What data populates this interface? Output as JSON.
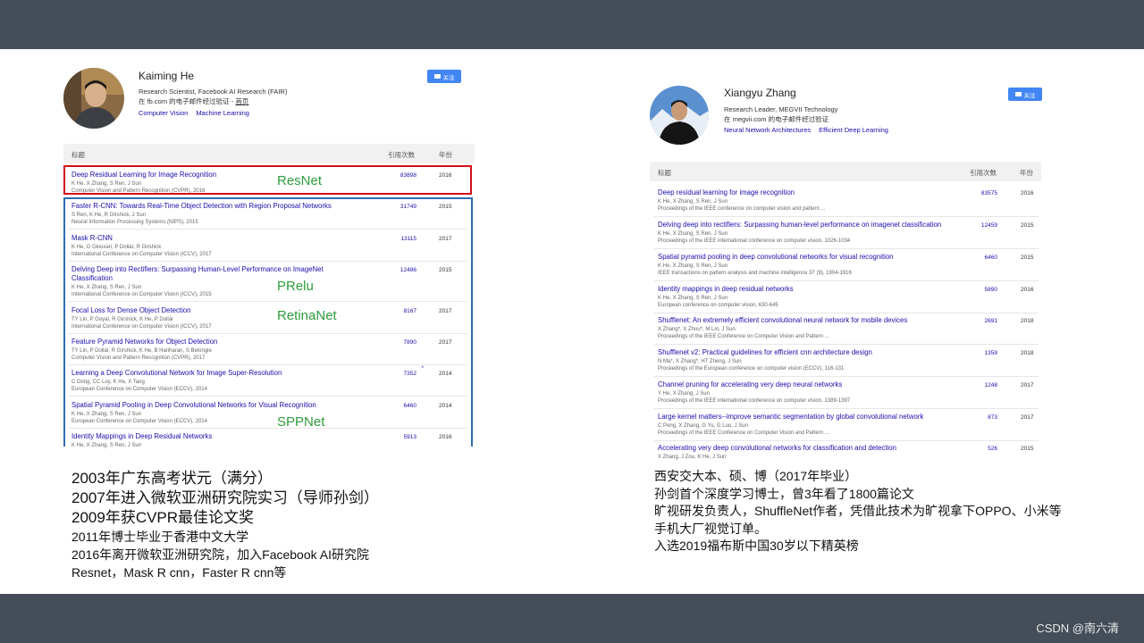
{
  "watermark": "CSDN @南六清",
  "left": {
    "name": "Kaiming He",
    "affiliation": "Research Scientist, Facebook AI Research (FAIR)",
    "email_prefix": "在 fb.com 的电子邮件经过验证 - ",
    "email_link": "首页",
    "tags": [
      "Computer Vision",
      "Machine Learning"
    ],
    "follow": "关注",
    "header": {
      "title": "标题",
      "cites": "引用次数",
      "year": "年份"
    },
    "rows": [
      {
        "title": "Deep Residual Learning for Image Recognition",
        "authors": "K He, X Zhang, S Ren, J Sun",
        "venue": "Computer Vision and Pattern Recognition (CVPR), 2016",
        "cites": "83898",
        "year": "2016"
      },
      {
        "title": "Faster R-CNN: Towards Real-Time Object Detection with Region Proposal Networks",
        "authors": "S Ren, K He, R Girshick, J Sun",
        "venue": "Neural Information Processing Systems (NIPS), 2015",
        "cites": "31749",
        "year": "2015"
      },
      {
        "title": "Mask R-CNN",
        "authors": "K He, G Gkioxari, P Dollár, R Girshick",
        "venue": "International Conference on Computer Vision (ICCV), 2017",
        "cites": "13115",
        "year": "2017"
      },
      {
        "title": "Delving Deep into Rectifiers: Surpassing Human-Level Performance on ImageNet",
        "title2": "Classification",
        "authors": "K He, X Zhang, S Ren, J Sun",
        "venue": "International Conference on Computer Vision (ICCV), 2015",
        "cites": "12486",
        "year": "2015"
      },
      {
        "title": "Focal Loss for Dense Object Detection",
        "authors": "TY Lin, P Goyal, R Girshick, K He, P Dollár",
        "venue": "International Conference on Computer Vision (ICCV), 2017",
        "cites": "8167",
        "year": "2017"
      },
      {
        "title": "Feature Pyramid Networks for Object Detection",
        "authors": "TY Lin, P Dollár, R Girshick, K He, B Hariharan, S Belongie",
        "venue": "Computer Vision and Pattern Recognition (CVPR), 2017",
        "cites": "7890",
        "year": "2017"
      },
      {
        "title": "Learning a Deep Convolutional Network for Image Super-Resolution",
        "authors": "C Dong, CC Loy, K He, X Tang",
        "venue": "European Conference on Computer Vision (ECCV), 2014",
        "cites": "7352",
        "year": "2014",
        "star": "*"
      },
      {
        "title": "Spatial Pyramid Pooling in Deep Convolutional Networks for Visual Recognition",
        "authors": "K He, X Zhang, S Ren, J Sun",
        "venue": "European Conference on Computer Vision (ECCV), 2014",
        "cites": "6460",
        "year": "2014"
      },
      {
        "title": "Identity Mappings in Deep Residual Networks",
        "authors": "K He, X Zhang, S Ren, J Sun",
        "venue": "",
        "cites": "5913",
        "year": "2016"
      }
    ],
    "labels": {
      "resnet": "ResNet",
      "prelu": "PRelu",
      "retinanet": "RetinaNet",
      "sppnet": "SPPNet"
    },
    "notes": [
      "2003年广东高考状元（满分）",
      "2007年进入微软亚洲研究院实习（导师孙剑）",
      "2009年获CVPR最佳论文奖",
      "2011年博士毕业于香港中文大学",
      "2016年离开微软亚洲研究院，加入Facebook  AI研究院",
      "Resnet，Mask R cnn，Faster R cnn等"
    ]
  },
  "right": {
    "name": "Xiangyu Zhang",
    "affiliation": "Research Leader, MEGVII Technology",
    "email": "在 megvii.com 的电子邮件经过验证",
    "tags": [
      "Neural Network Architectures",
      "Efficient Deep Learning"
    ],
    "follow": "关注",
    "header": {
      "title": "标题",
      "cites": "引用次数",
      "year": "年份"
    },
    "rows": [
      {
        "title": "Deep residual learning for image recognition",
        "authors": "K He, X Zhang, S Ren, J Sun",
        "venue": "Proceedings of the IEEE conference on computer vision and pattern ...",
        "cites": "83575",
        "year": "2016"
      },
      {
        "title": "Delving deep into rectifiers: Surpassing human-level performance on imagenet classification",
        "authors": "K He, X Zhang, S Ren, J Sun",
        "venue": "Proceedings of the IEEE international conference on computer vision, 1026-1034",
        "cites": "12459",
        "year": "2015"
      },
      {
        "title": "Spatial pyramid pooling in deep convolutional networks for visual recognition",
        "authors": "K He, X Zhang, S Ren, J Sun",
        "venue": "IEEE transactions on pattern analysis and machine intelligence 37 (9), 1904-1916",
        "cites": "6460",
        "year": "2015"
      },
      {
        "title": "Identity mappings in deep residual networks",
        "authors": "K He, X Zhang, S Ren, J Sun",
        "venue": "European conference on computer vision, 630-645",
        "cites": "5890",
        "year": "2016"
      },
      {
        "title": "Shufflenet: An extremely efficient convolutional neural network for mobile devices",
        "authors": "X Zhang*, X Zhou*, M Lin, J Sun",
        "venue": "Proceedings of the IEEE Conference on Computer Vision and Pattern ...",
        "cites": "2691",
        "year": "2018"
      },
      {
        "title": "Shufflenet v2: Practical guidelines for efficient cnn architecture design",
        "authors": "N Ma*, X Zhang*, HT Zheng, J Sun",
        "venue": "Proceedings of the European conference on computer vision (ECCV), 116-131",
        "cites": "1359",
        "year": "2018"
      },
      {
        "title": "Channel pruning for accelerating very deep neural networks",
        "authors": "Y He, X Zhang, J Sun",
        "venue": "Proceedings of the IEEE international conference on computer vision, 1389-1397",
        "cites": "1248",
        "year": "2017"
      },
      {
        "title": "Large kernel matters--improve semantic segmentation by global convolutional network",
        "authors": "C Peng, X Zhang, G Yu, G Luo, J Sun",
        "venue": "Proceedings of the IEEE Conference on Computer Vision and Pattern ...",
        "cites": "873",
        "year": "2017"
      },
      {
        "title": "Accelerating very deep convolutional networks for classification and detection",
        "authors": "X Zhang, J Zou, K He, J Sun",
        "venue": "",
        "cites": "526",
        "year": "2015"
      }
    ],
    "notes": [
      "西安交大本、硕、博（2017年毕业）",
      "孙剑首个深度学习博士，曾3年看了1800篇论文",
      "旷视研发负责人，ShuffleNet作者，凭借此技术为旷视拿下OPPO、小米等",
      "手机大厂视觉订单。",
      "入选2019福布斯中国30岁以下精英榜"
    ]
  }
}
